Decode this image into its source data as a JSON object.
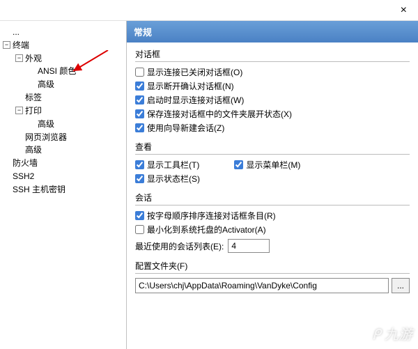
{
  "titlebar": {
    "close": "×"
  },
  "tree": {
    "root0": "...",
    "terminal": "终端",
    "appearance": "外观",
    "ansi": "ANSI 颜色",
    "adv1": "高级",
    "tabs": "标签",
    "print": "打印",
    "adv2": "高级",
    "web": "网页浏览器",
    "adv3": "高级",
    "firewall": "防火墙",
    "ssh2": "SSH2",
    "sshkey": "SSH 主机密钥",
    "expand": "−",
    "collapse": "+"
  },
  "header": "常规",
  "groups": {
    "dialog": {
      "title": "对话框",
      "opt1": {
        "label": "显示连接已关闭对话框(O)",
        "checked": false
      },
      "opt2": {
        "label": "显示断开确认对话框(N)",
        "checked": true
      },
      "opt3": {
        "label": "启动时显示连接对话框(W)",
        "checked": true
      },
      "opt4": {
        "label": "保存连接对话框中的文件夹展开状态(X)",
        "checked": true
      },
      "opt5": {
        "label": "使用向导新建会话(Z)",
        "checked": true
      }
    },
    "view": {
      "title": "查看",
      "opt1": {
        "label": "显示工具栏(T)",
        "checked": true
      },
      "opt2": {
        "label": "显示菜单栏(M)",
        "checked": true
      },
      "opt3": {
        "label": "显示状态栏(S)",
        "checked": true
      }
    },
    "session": {
      "title": "会话",
      "opt1": {
        "label": "按字母顺序排序连接对话框条目(R)",
        "checked": true
      },
      "opt2": {
        "label": "最小化到系统托盘的Activator(A)",
        "checked": false
      },
      "recent_label": "最近使用的会话列表(E):",
      "recent_value": "4"
    },
    "config": {
      "title": "配置文件夹(F)",
      "path": "C:\\Users\\chj\\AppData\\Roaming\\VanDyke\\Config",
      "browse": "..."
    }
  },
  "watermark": "ᑭ 九游"
}
